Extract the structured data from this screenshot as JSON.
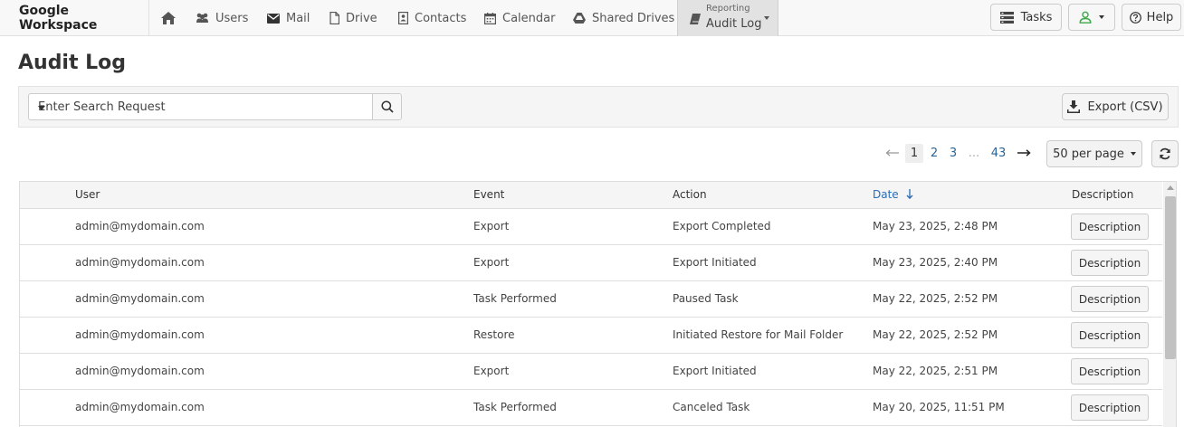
{
  "nav": {
    "brand": "Google Workspace",
    "items": [
      {
        "label": "Users"
      },
      {
        "label": "Mail"
      },
      {
        "label": "Drive"
      },
      {
        "label": "Contacts"
      },
      {
        "label": "Calendar"
      },
      {
        "label": "Shared Drives"
      }
    ],
    "active": {
      "small": "Reporting",
      "label": "Audit Log"
    },
    "tasks_label": "Tasks",
    "help_label": "Help"
  },
  "page": {
    "title": "Audit Log"
  },
  "search": {
    "placeholder": "Enter Search Request",
    "export_label": "Export (CSV)"
  },
  "pagination": {
    "pages": [
      "1",
      "2",
      "3"
    ],
    "ellipsis": "...",
    "last": "43",
    "active_page": "1",
    "per_page": "50 per page"
  },
  "table": {
    "columns": {
      "user": "User",
      "event": "Event",
      "action": "Action",
      "date": "Date",
      "description": "Description"
    },
    "sort_column": "Date",
    "sort_direction": "descending",
    "rows": [
      {
        "user": "admin@mydomain.com",
        "event": "Export",
        "action": "Export Completed",
        "date": "May 23, 2025, 2:48 PM",
        "button": "Description"
      },
      {
        "user": "admin@mydomain.com",
        "event": "Export",
        "action": "Export Initiated",
        "date": "May 23, 2025, 2:40 PM",
        "button": "Description"
      },
      {
        "user": "admin@mydomain.com",
        "event": "Task Performed",
        "action": "Paused Task",
        "date": "May 22, 2025, 2:52 PM",
        "button": "Description"
      },
      {
        "user": "admin@mydomain.com",
        "event": "Restore",
        "action": "Initiated Restore for Mail Folder",
        "date": "May 22, 2025, 2:52 PM",
        "button": "Description"
      },
      {
        "user": "admin@mydomain.com",
        "event": "Export",
        "action": "Export Initiated",
        "date": "May 22, 2025, 2:51 PM",
        "button": "Description"
      },
      {
        "user": "admin@mydomain.com",
        "event": "Task Performed",
        "action": "Canceled Task",
        "date": "May 20, 2025, 11:51 PM",
        "button": "Description"
      }
    ]
  },
  "colors": {
    "accent": "#2a6db5",
    "user_icon": "#3ea84a"
  }
}
